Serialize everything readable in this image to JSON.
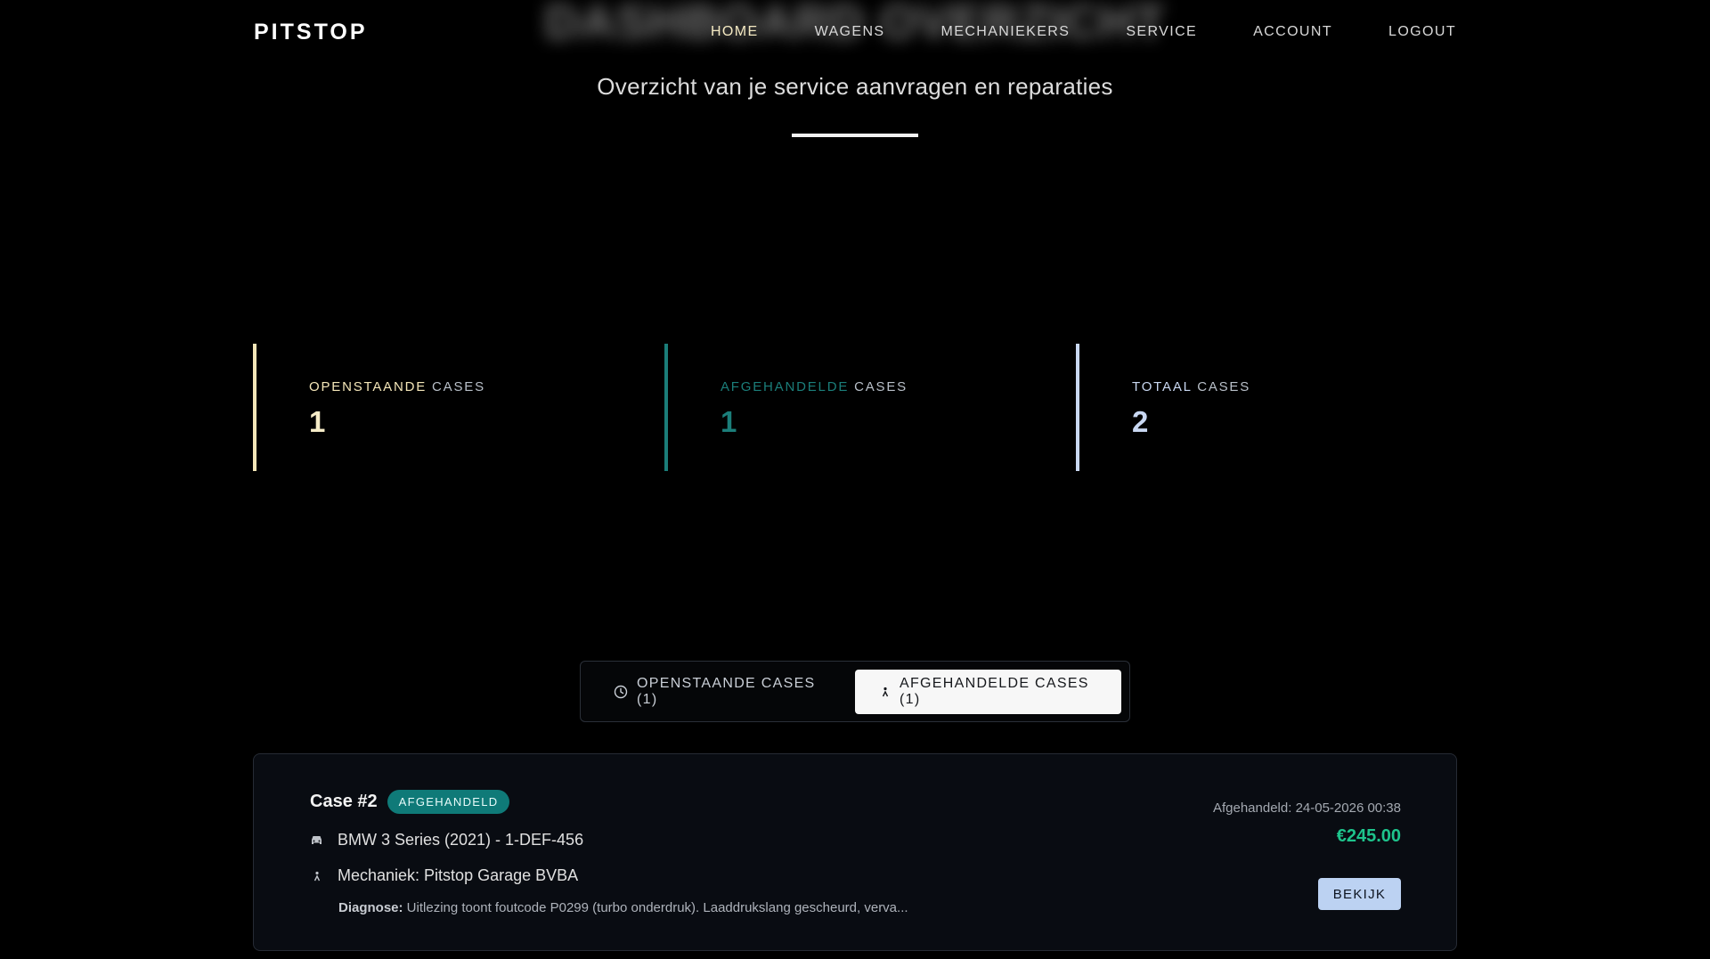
{
  "hero": {
    "blurred_title": "DASHBOARD OVERZICHT"
  },
  "nav": {
    "logo": "PITSTOP",
    "links": [
      {
        "label": "HOME",
        "active": true
      },
      {
        "label": "WAGENS",
        "active": false
      },
      {
        "label": "MECHANIEKERS",
        "active": false
      },
      {
        "label": "SERVICE",
        "active": false
      },
      {
        "label": "ACCOUNT",
        "active": false
      },
      {
        "label": "LOGOUT",
        "active": false
      }
    ]
  },
  "subtitle": "Overzicht van je service aanvragen en reparaties",
  "stats": [
    {
      "label_accent": "OPENSTAANDE",
      "label_rest": "CASES",
      "value": "1",
      "color": "#f4e6b8"
    },
    {
      "label_accent": "AFGEHANDELDE",
      "label_rest": "CASES",
      "value": "1",
      "color": "#1b7e7a"
    },
    {
      "label_accent": "TOTAAL",
      "label_rest": "CASES",
      "value": "2",
      "color": "#c9d8f2"
    }
  ],
  "tabs": [
    {
      "label": "OPENSTAANDE CASES (1)",
      "icon": "clock-icon",
      "active": false
    },
    {
      "label": "AFGEHANDELDE CASES (1)",
      "icon": "mechanic-icon",
      "active": true
    }
  ],
  "case": {
    "title": "Case #2",
    "status": "AFGEHANDELD",
    "vehicle": "BMW 3 Series (2021) - 1-DEF-456",
    "vehicle_icon": "car-icon",
    "mechanic": "Mechaniek: Pitstop Garage BVBA",
    "mechanic_icon": "mechanic-icon",
    "diagnose_label": "Diagnose:",
    "diagnose_text": " Uitlezing toont foutcode P0299 (turbo onderdruk). Laaddrukslang gescheurd, verva...",
    "completed": "Afgehandeld: 24-05-2026 00:38",
    "price": "€245.00",
    "button_label": "BEKIJK"
  },
  "colors": {
    "background": "#000000",
    "nav_active": "#f4e9c2",
    "price": "#1ec48c",
    "badge": "#0f7a78",
    "button": "#bcd2f2"
  }
}
